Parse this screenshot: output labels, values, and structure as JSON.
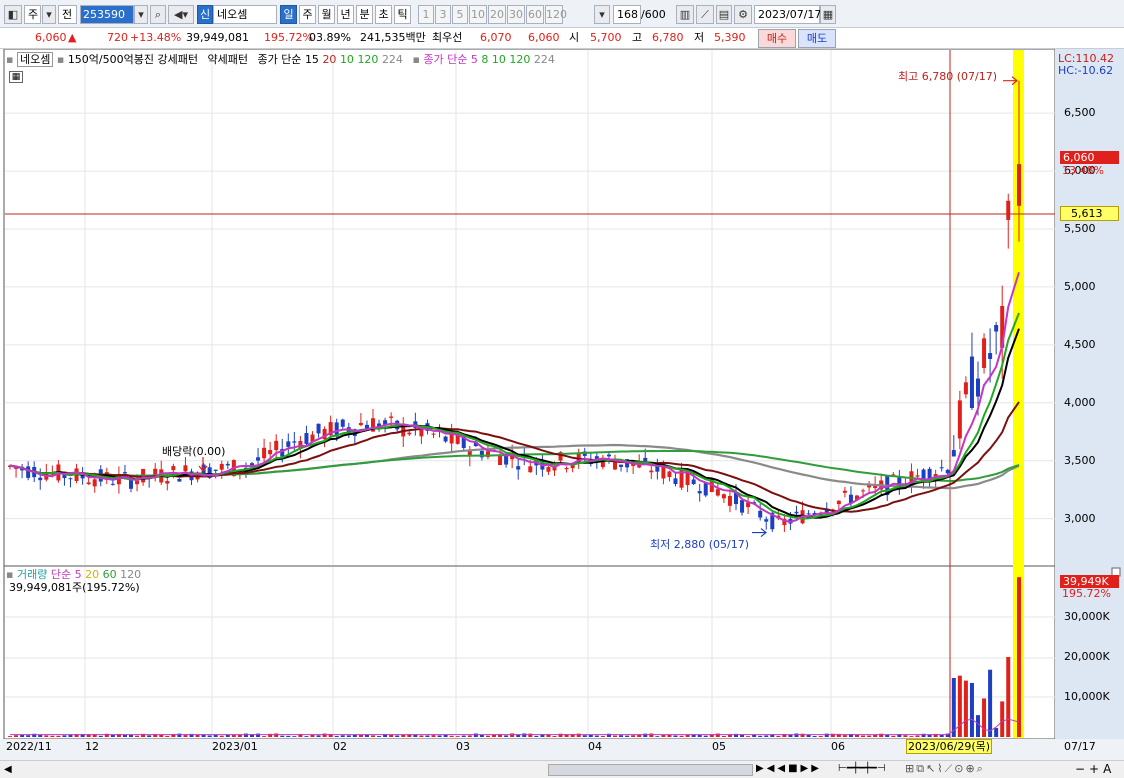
{
  "toolbar": {
    "market_label": "주",
    "mode_label": "전",
    "stock_code": "253590",
    "stock_badge": "신",
    "stock_name": "네오셈",
    "periods": [
      "일",
      "주",
      "월",
      "년",
      "분",
      "초",
      "틱"
    ],
    "active_period": "일",
    "intervals": [
      "1",
      "3",
      "5",
      "10",
      "20",
      "30",
      "60",
      "120"
    ],
    "count": "168",
    "count_total": "/600",
    "date": "2023/07/17"
  },
  "quote": {
    "price": "6,060",
    "change": "720",
    "change_pct": "+13.48%",
    "volume": "39,949,081",
    "volume_pct": "195.72%",
    "turnover_pct": "03.89%",
    "amount": "241,535백만",
    "best_ask_label": "최우선",
    "best_ask": "6,070",
    "best_bid": "6,060",
    "open_label": "시",
    "open": "5,700",
    "high_label": "고",
    "high": "6,780",
    "low_label": "저",
    "low": "5,390",
    "buy_label": "매수",
    "sell_label": "매도"
  },
  "price_legend": {
    "name": "네오셈",
    "indicator": "150억/500억봉진 강세패턴",
    "indicator2": "약세패턴",
    "ma_close_label": "종가 단순",
    "ma_close_periods": [
      "15",
      "20",
      "10",
      "120",
      "224"
    ],
    "ma2_label": "종가 단순",
    "ma2_periods": [
      "5",
      "8",
      "10",
      "120",
      "224"
    ]
  },
  "volume_legend": {
    "name": "거래량",
    "ma_label": "단순",
    "periods": [
      "5",
      "20",
      "60",
      "120"
    ],
    "current": "39,949,081주(195.72%)"
  },
  "price_axis": {
    "ticks": [
      "6,500",
      "6,000",
      "5,500",
      "5,000",
      "4,500",
      "4,000",
      "3,500",
      "3,000"
    ],
    "lc": "LC:110.42",
    "hc": "HC:-10.62",
    "current_price": "6,060",
    "current_pct": "13.48%",
    "crosshair_price": "5,613"
  },
  "volume_axis": {
    "ticks": [
      "30,000K",
      "20,000K",
      "10,000K"
    ],
    "current": "39,949K",
    "current_pct": "195.72%"
  },
  "time_axis": {
    "labels": [
      "2022/11",
      "12",
      "2023/01",
      "02",
      "03",
      "04",
      "05",
      "06",
      "07/17"
    ],
    "crosshair_date": "2023/06/29(목)"
  },
  "annotations": {
    "high": "최고 6,780 (07/17)",
    "low": "최저 2,880 (05/17)",
    "dividend": "배당락(0.00)"
  },
  "colors": {
    "up": "#e0201b",
    "down": "#1c3fc4",
    "ma5": "#c436c4",
    "ma8": "#1fa81f",
    "ma10": "#000000",
    "ma20": "#7a1010",
    "ma120": "#8a8a8a",
    "ma224": "#2e9e3a",
    "highlight": "#ffff00"
  },
  "chart_data": {
    "type": "candlestick",
    "title": "",
    "ylim": [
      2600,
      6950
    ],
    "months": [
      "2022/11",
      "12",
      "2023/01",
      "02",
      "03",
      "04",
      "05",
      "06",
      "07"
    ],
    "close_series": [
      [
        "2022-11",
        3450
      ],
      [
        "2022-11-15",
        3380
      ],
      [
        "2022-12",
        3330
      ],
      [
        "2022-12-15",
        3400
      ],
      [
        "2023-01",
        3450
      ],
      [
        "2023-01-15",
        3700
      ],
      [
        "2023-02",
        3830
      ],
      [
        "2023-02-15",
        3750
      ],
      [
        "2023-03",
        3600
      ],
      [
        "2023-03-15",
        3480
      ],
      [
        "2023-04",
        3520
      ],
      [
        "2023-04-15",
        3430
      ],
      [
        "2023-05",
        3250
      ],
      [
        "2023-05-17",
        2950
      ],
      [
        "2023-06",
        3150
      ],
      [
        "2023-06-15",
        3300
      ],
      [
        "2023-06-29",
        3450
      ],
      [
        "2023-07-05",
        4150
      ],
      [
        "2023-07-13",
        4600
      ],
      [
        "2023-07-14",
        5340
      ],
      [
        "2023-07-17",
        6060
      ]
    ],
    "last_candle": {
      "date": "2023/07/17",
      "open": 5700,
      "high": 6780,
      "low": 5390,
      "close": 6060
    },
    "high": {
      "date": "07/17",
      "value": 6780
    },
    "low": {
      "date": "05/17",
      "value": 2880
    },
    "volume_last": 39949081
  }
}
